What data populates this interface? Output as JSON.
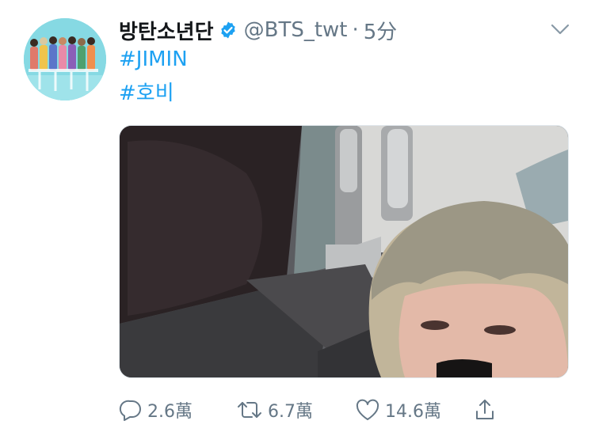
{
  "tweet": {
    "display_name": "방탄소년단",
    "handle": "@BTS_twt",
    "separator": "·",
    "time": "5分",
    "hashtags": [
      "#JIMIN",
      "#호비"
    ],
    "verified_icon": "verified-badge-icon",
    "link_color": "#1da1f2",
    "muted_color": "#657786"
  },
  "actions": {
    "reply_count": "2.6萬",
    "retweet_count": "6.7萬",
    "like_count": "14.6萬"
  }
}
